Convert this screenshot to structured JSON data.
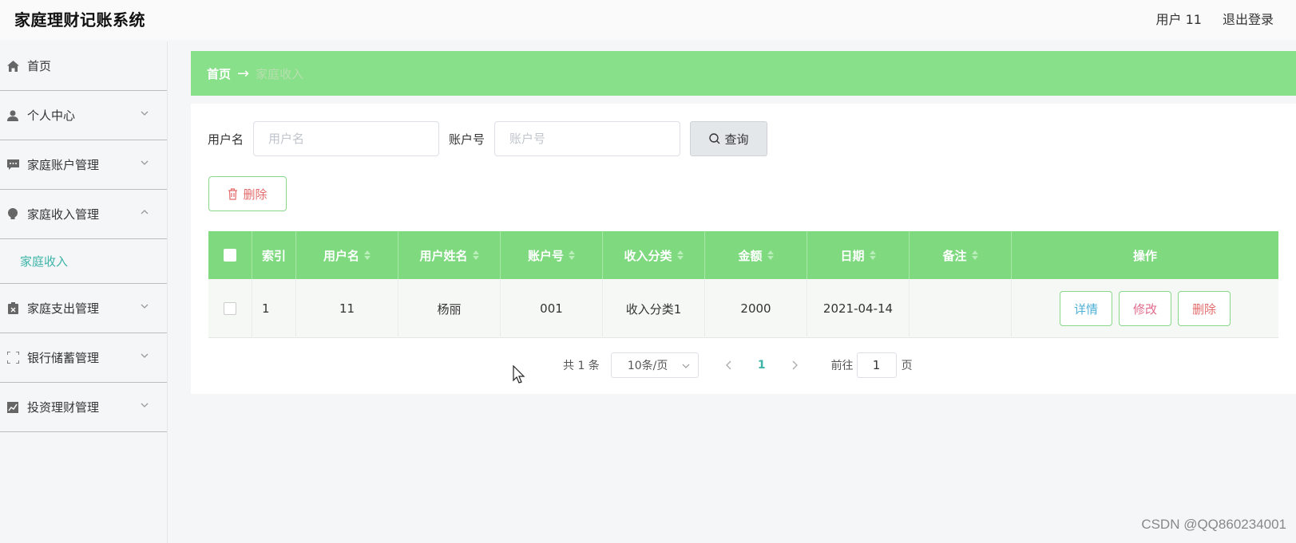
{
  "header": {
    "title": "家庭理财记账系统",
    "user_label": "用户 11",
    "logout_label": "退出登录"
  },
  "sidebar": {
    "items": [
      {
        "label": "首页",
        "icon": "home-icon"
      },
      {
        "label": "个人中心",
        "icon": "user-icon"
      },
      {
        "label": "家庭账户管理",
        "icon": "message-icon"
      },
      {
        "label": "家庭收入管理",
        "icon": "bulb-icon",
        "expanded": true,
        "children": [
          {
            "label": "家庭收入"
          }
        ]
      },
      {
        "label": "家庭支出管理",
        "icon": "clipboard-icon"
      },
      {
        "label": "银行储蓄管理",
        "icon": "frame-icon"
      },
      {
        "label": "投资理财管理",
        "icon": "chart-icon"
      }
    ]
  },
  "breadcrumb": {
    "home": "首页",
    "separator": "→",
    "current": "家庭收入"
  },
  "search": {
    "username_label": "用户名",
    "username_placeholder": "用户名",
    "account_label": "账户号",
    "account_placeholder": "账户号",
    "query_label": "查询"
  },
  "actions": {
    "delete_label": "删除"
  },
  "table": {
    "columns": [
      "",
      "索引",
      "用户名",
      "用户姓名",
      "账户号",
      "收入分类",
      "金额",
      "日期",
      "备注",
      "操作"
    ],
    "rows": [
      {
        "index": "1",
        "username": "11",
        "name": "杨丽",
        "account": "001",
        "category": "收入分类1",
        "amount": "2000",
        "date": "2021-04-14",
        "note": ""
      }
    ],
    "row_actions": {
      "detail": "详情",
      "edit": "修改",
      "delete": "删除"
    }
  },
  "pagination": {
    "total": "共 1 条",
    "page_size": "10条/页",
    "current_page": "1",
    "goto_label": "前往",
    "goto_value": "1",
    "page_suffix": "页"
  },
  "watermark": "CSDN @QQ860234001",
  "colors": {
    "accent_green": "#89e08b",
    "table_header": "#7ed97f",
    "submenu_active": "#3cb4a8",
    "danger": "#e36a6a"
  }
}
